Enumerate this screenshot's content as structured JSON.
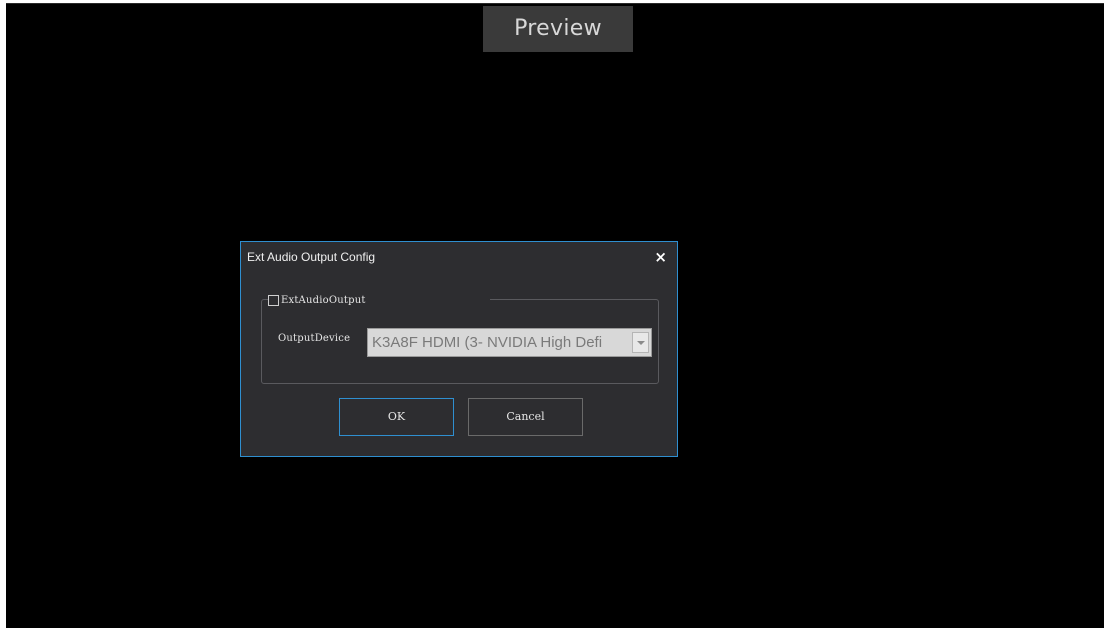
{
  "preview": {
    "tab_label": "Preview"
  },
  "dialog": {
    "title": "Ext Audio Output Config",
    "close_glyph": "×",
    "ext_audio_output": {
      "label": "ExtAudioOutput",
      "checked": false
    },
    "output_device": {
      "label": "OutputDevice",
      "value": "K3A8F HDMI (3- NVIDIA High Defi"
    },
    "ok_label": "OK",
    "cancel_label": "Cancel"
  },
  "colors": {
    "accent": "#2f8fd0",
    "dialog_bg": "#2d2d30",
    "preview_bg": "#000000"
  }
}
